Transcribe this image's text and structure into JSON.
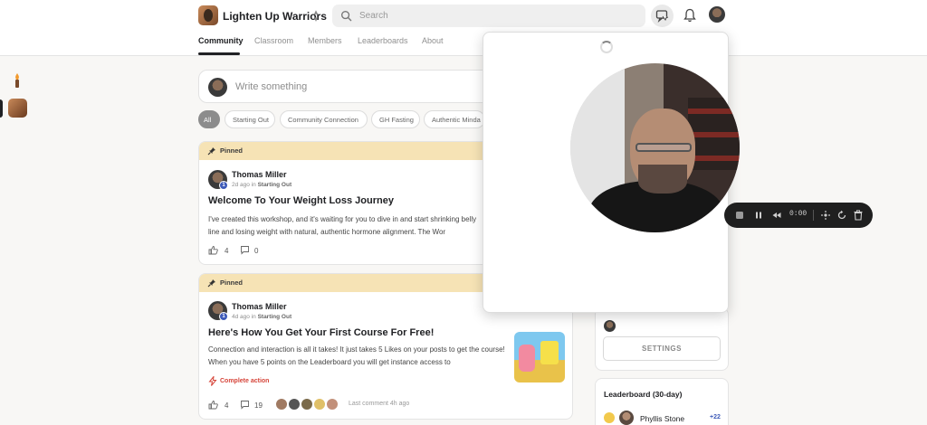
{
  "header": {
    "community_name": "Lighten Up Warriors",
    "search_placeholder": "Search"
  },
  "tabs": [
    "Community",
    "Classroom",
    "Members",
    "Leaderboards",
    "About"
  ],
  "composer": {
    "placeholder": "Write something"
  },
  "filters": [
    "All",
    "Starting Out",
    "Community Connection",
    "GH Fasting",
    "Authentic Minda"
  ],
  "posts": [
    {
      "pinned_label": "Pinned",
      "author": "Thomas Miller",
      "level": "1",
      "time": "2d ago in",
      "category": "Starting Out",
      "title": "Welcome To Your Weight Loss Journey",
      "body": "I've created this workshop, and it's waiting for you to dive in and start shrinking belly line and losing weight with natural, authentic hormone alignment. The Wor",
      "likes": "4",
      "comments": "0"
    },
    {
      "pinned_label": "Pinned",
      "author": "Thomas Miller",
      "level": "1",
      "time": "4d ago in",
      "category": "Starting Out",
      "title": "Here's How You Get Your First Course For Free!",
      "body": "Connection and interaction is all it takes! It just takes 5 Likes on your posts to get the course! When you have 5 points on the Leaderboard you will get instance access to",
      "action_label": "Complete action",
      "likes": "4",
      "comments": "19",
      "last_comment": "Last comment 4h ago"
    }
  ],
  "sidebar": {
    "settings_label": "SETTINGS",
    "leaderboard_title": "Leaderboard (30-day)",
    "leaderboard": [
      {
        "name": "Phyllis Stone",
        "points": "+22"
      }
    ]
  },
  "recorder": {
    "time": "0:00"
  },
  "colors": {
    "pinned_bg": "#f6e3b5",
    "level_badge": "#3d5ab8",
    "action_red": "#d6453a",
    "recorder_bg": "#1f1f1f"
  }
}
